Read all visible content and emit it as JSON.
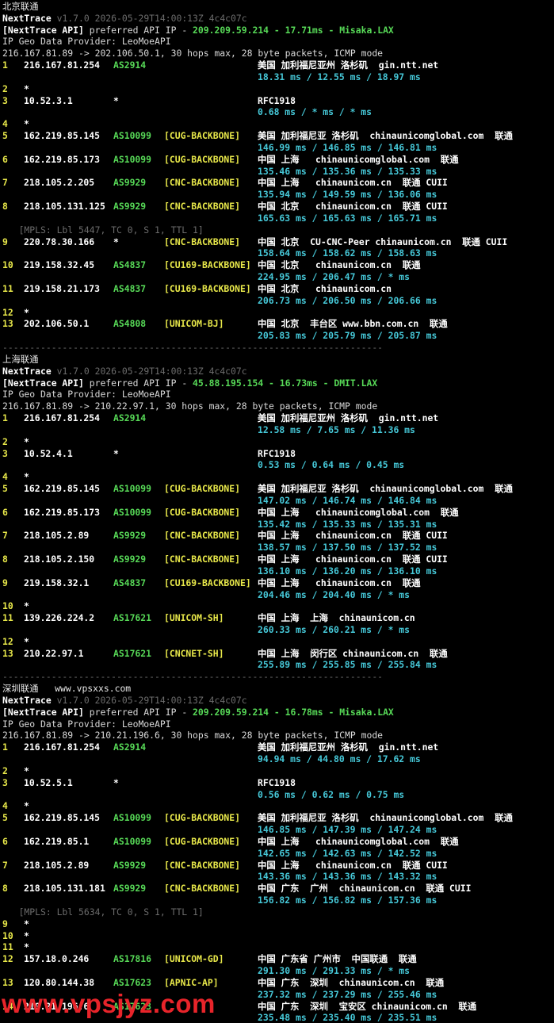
{
  "blocks": [
    {
      "title": "北京联通",
      "title_extra": "",
      "app": "NextTrace",
      "version": "v1.7.0 2026-05-29T14:00:13Z 4c4c07c",
      "api_prefix": "[NextTrace API]",
      "api_mid": " preferred API IP - ",
      "api_ip": "209.209.59.214",
      "api_latency": " - 17.71ms - ",
      "api_node": "Misaka.LAX",
      "geo": "IP Geo Data Provider: LeoMoeAPI",
      "cmd": "216.167.81.89 -> 202.106.50.1, 30 hops max, 28 byte packets, ICMP mode",
      "hops": [
        {
          "n": "1",
          "ip": "216.167.81.254",
          "as": "AS2914",
          "tag": "",
          "geo": "美国 加利福尼亚州 洛杉矶  gin.ntt.net",
          "rtt": "18.31 ms / 12.55 ms / 18.97 ms"
        },
        {
          "n": "2",
          "ip": "*"
        },
        {
          "n": "3",
          "ip": "10.52.3.1",
          "as": "*",
          "tag": "",
          "geo": "RFC1918",
          "rtt": "0.68 ms / * ms / * ms"
        },
        {
          "n": "4",
          "ip": "*"
        },
        {
          "n": "5",
          "ip": "162.219.85.145",
          "as": "AS10099",
          "tag": "[CUG-BACKBONE]",
          "geo": "美国 加利福尼亚 洛杉矶  chinaunicomglobal.com  联通",
          "rtt": "146.99 ms / 146.85 ms / 146.81 ms"
        },
        {
          "n": "6",
          "ip": "162.219.85.173",
          "as": "AS10099",
          "tag": "[CUG-BACKBONE]",
          "geo": "中国 上海   chinaunicomglobal.com  联通",
          "rtt": "135.46 ms / 135.36 ms / 135.33 ms"
        },
        {
          "n": "7",
          "ip": "218.105.2.205",
          "as": "AS9929",
          "tag": "[CNC-BACKBONE]",
          "geo": "中国 上海   chinaunicom.cn  联通 CUII",
          "rtt": "135.94 ms / 149.59 ms / 136.06 ms"
        },
        {
          "n": "8",
          "ip": "218.105.131.125",
          "as": "AS9929",
          "tag": "[CNC-BACKBONE]",
          "geo": "中国 北京   chinaunicom.cn  联通 CUII",
          "rtt": "165.63 ms / 165.63 ms / 165.71 ms"
        },
        {
          "mpls": "   [MPLS: Lbl 5447, TC 0, S 1, TTL 1]"
        },
        {
          "n": "9",
          "ip": "220.78.30.166",
          "as": "*",
          "tag": "[CNC-BACKBONE]",
          "geo": "中国 北京  CU-CNC-Peer chinaunicom.cn  联通 CUII",
          "rtt": "158.64 ms / 158.62 ms / 158.63 ms"
        },
        {
          "n": "10",
          "ip": "219.158.32.45",
          "as": "AS4837",
          "tag": "[CU169-BACKBONE]",
          "geo": "中国 北京   chinaunicom.cn  联通",
          "rtt": "224.95 ms / 206.47 ms / * ms"
        },
        {
          "n": "11",
          "ip": "219.158.21.173",
          "as": "AS4837",
          "tag": "[CU169-BACKBONE]",
          "geo": "中国 北京   chinaunicom.cn",
          "rtt": "206.73 ms / 206.50 ms / 206.66 ms"
        },
        {
          "n": "12",
          "ip": "*"
        },
        {
          "n": "13",
          "ip": "202.106.50.1",
          "as": "AS4808",
          "tag": "[UNICOM-BJ]",
          "geo": "中国 北京  丰台区 www.bbn.com.cn  联通",
          "rtt": "205.83 ms / 205.79 ms / 205.87 ms"
        }
      ]
    },
    {
      "title": "上海联通",
      "title_extra": "",
      "app": "NextTrace",
      "version": "v1.7.0 2026-05-29T14:00:13Z 4c4c07c",
      "api_prefix": "[NextTrace API]",
      "api_mid": " preferred API IP - ",
      "api_ip": "45.88.195.154",
      "api_latency": " - 16.73ms - ",
      "api_node": "DMIT.LAX",
      "geo": "IP Geo Data Provider: LeoMoeAPI",
      "cmd": "216.167.81.89 -> 210.22.97.1, 30 hops max, 28 byte packets, ICMP mode",
      "hops": [
        {
          "n": "1",
          "ip": "216.167.81.254",
          "as": "AS2914",
          "tag": "",
          "geo": "美国 加利福尼亚州 洛杉矶  gin.ntt.net",
          "rtt": "12.58 ms / 7.65 ms / 11.36 ms"
        },
        {
          "n": "2",
          "ip": "*"
        },
        {
          "n": "3",
          "ip": "10.52.4.1",
          "as": "*",
          "tag": "",
          "geo": "RFC1918",
          "rtt": "0.53 ms / 0.64 ms / 0.45 ms"
        },
        {
          "n": "4",
          "ip": "*"
        },
        {
          "n": "5",
          "ip": "162.219.85.145",
          "as": "AS10099",
          "tag": "[CUG-BACKBONE]",
          "geo": "美国 加利福尼亚 洛杉矶  chinaunicomglobal.com  联通",
          "rtt": "147.02 ms / 146.74 ms / 146.84 ms"
        },
        {
          "n": "6",
          "ip": "162.219.85.173",
          "as": "AS10099",
          "tag": "[CUG-BACKBONE]",
          "geo": "中国 上海   chinaunicomglobal.com  联通",
          "rtt": "135.42 ms / 135.33 ms / 135.31 ms"
        },
        {
          "n": "7",
          "ip": "218.105.2.89",
          "as": "AS9929",
          "tag": "[CNC-BACKBONE]",
          "geo": "中国 上海   chinaunicom.cn  联通 CUII",
          "rtt": "138.57 ms / 137.50 ms / 137.52 ms"
        },
        {
          "n": "8",
          "ip": "218.105.2.150",
          "as": "AS9929",
          "tag": "[CNC-BACKBONE]",
          "geo": "中国 上海   chinaunicom.cn  联通 CUII",
          "rtt": "136.10 ms / 136.20 ms / 136.10 ms"
        },
        {
          "n": "9",
          "ip": "219.158.32.1",
          "as": "AS4837",
          "tag": "[CU169-BACKBONE]",
          "geo": "中国 上海   chinaunicom.cn  联通",
          "rtt": "204.46 ms / 204.40 ms / * ms"
        },
        {
          "n": "10",
          "ip": "*"
        },
        {
          "n": "11",
          "ip": "139.226.224.2",
          "as": "AS17621",
          "tag": "[UNICOM-SH]",
          "geo": "中国 上海  上海  chinaunicom.cn",
          "rtt": "260.33 ms / 260.21 ms / * ms"
        },
        {
          "n": "12",
          "ip": "*"
        },
        {
          "n": "13",
          "ip": "210.22.97.1",
          "as": "AS17621",
          "tag": "[CNCNET-SH]",
          "geo": "中国 上海  闵行区 chinaunicom.cn  联通",
          "rtt": "255.89 ms / 255.85 ms / 255.84 ms"
        }
      ]
    },
    {
      "title": "深圳联通",
      "title_extra": "   www.vpsxxs.com",
      "app": "NextTrace",
      "version": "v1.7.0 2026-05-29T14:00:13Z 4c4c07c",
      "api_prefix": "[NextTrace API]",
      "api_mid": " preferred API IP - ",
      "api_ip": "209.209.59.214",
      "api_latency": " - 16.78ms - ",
      "api_node": "Misaka.LAX",
      "geo": "IP Geo Data Provider: LeoMoeAPI",
      "cmd": "216.167.81.89 -> 210.21.196.6, 30 hops max, 28 byte packets, ICMP mode",
      "hops": [
        {
          "n": "1",
          "ip": "216.167.81.254",
          "as": "AS2914",
          "tag": "",
          "geo": "美国 加利福尼亚州 洛杉矶  gin.ntt.net",
          "rtt": "94.94 ms / 44.80 ms / 17.62 ms"
        },
        {
          "n": "2",
          "ip": "*"
        },
        {
          "n": "3",
          "ip": "10.52.5.1",
          "as": "*",
          "tag": "",
          "geo": "RFC1918",
          "rtt": "0.56 ms / 0.62 ms / 0.75 ms"
        },
        {
          "n": "4",
          "ip": "*"
        },
        {
          "n": "5",
          "ip": "162.219.85.145",
          "as": "AS10099",
          "tag": "[CUG-BACKBONE]",
          "geo": "美国 加利福尼亚 洛杉矶  chinaunicomglobal.com  联通",
          "rtt": "146.85 ms / 147.39 ms / 147.24 ms"
        },
        {
          "n": "6",
          "ip": "162.219.85.1",
          "as": "AS10099",
          "tag": "[CUG-BACKBONE]",
          "geo": "中国 上海   chinaunicomglobal.com  联通",
          "rtt": "142.65 ms / 142.63 ms / 142.52 ms"
        },
        {
          "n": "7",
          "ip": "218.105.2.89",
          "as": "AS9929",
          "tag": "[CNC-BACKBONE]",
          "geo": "中国 上海   chinaunicom.cn  联通 CUII",
          "rtt": "143.36 ms / 143.36 ms / 143.32 ms"
        },
        {
          "n": "8",
          "ip": "218.105.131.181",
          "as": "AS9929",
          "tag": "[CNC-BACKBONE]",
          "geo": "中国 广东  广州  chinaunicom.cn  联通 CUII",
          "rtt": "156.82 ms / 156.82 ms / 157.36 ms"
        },
        {
          "mpls": "   [MPLS: Lbl 5634, TC 0, S 1, TTL 1]"
        },
        {
          "n": "9",
          "ip": "*"
        },
        {
          "n": "10",
          "ip": "*"
        },
        {
          "n": "11",
          "ip": "*"
        },
        {
          "n": "12",
          "ip": "157.18.0.246",
          "as": "AS17816",
          "tag": "[UNICOM-GD]",
          "geo": "中国 广东省 广州市  中国联通  联通",
          "rtt": "291.30 ms / 291.33 ms / * ms"
        },
        {
          "n": "13",
          "ip": "120.80.144.38",
          "as": "AS17623",
          "tag": "[APNIC-AP]",
          "geo": "中国 广东  深圳  chinaunicom.cn  联通",
          "rtt": "237.32 ms / 237.29 ms / 255.46 ms"
        },
        {
          "n": "14",
          "ip": "210.21.196.6",
          "as": "AS17623",
          "tag": "",
          "geo": "中国 广东  深圳  宝安区 chinaunicom.cn  联通",
          "rtt": "235.48 ms / 235.40 ms / 235.51 ms"
        }
      ]
    }
  ],
  "separator": "----------------------------------------------------------------------",
  "watermark": "www.vpsjyz.com",
  "colors": {
    "ip": "#ffffff",
    "asn": "#57d957",
    "tag": "#e8e84a",
    "rtt": "#46c8d8",
    "watermark": "#e8242a"
  }
}
